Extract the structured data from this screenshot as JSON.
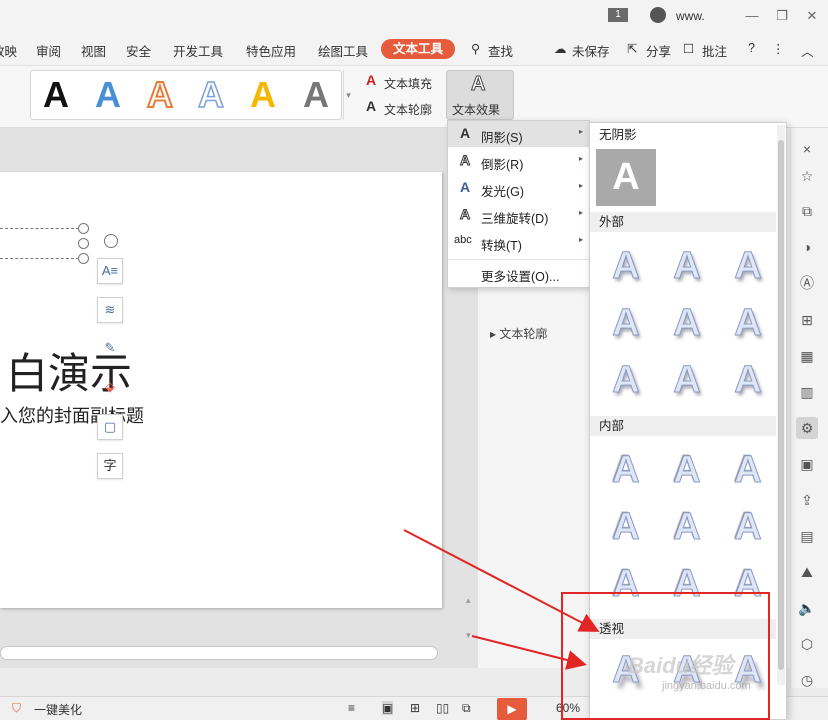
{
  "titlebar": {
    "page_indicator": "1",
    "user_name": "www.",
    "min": "—",
    "restore": "❐",
    "close": "✕"
  },
  "menu_tabs": [
    "放映",
    "审阅",
    "视图",
    "安全",
    "开发工具",
    "特色应用",
    "绘图工具"
  ],
  "active_tab": "文本工具",
  "search_label": "查找",
  "toolbar_right": {
    "unsaved": "未保存",
    "share": "分享",
    "annotate": "批注",
    "help": "?",
    "more": "⋮",
    "collapse": "︿"
  },
  "style_colors": [
    "#111111",
    "#4a8fd4",
    "#e67c3a",
    "#7aa2d8",
    "#f5b800",
    "#777777"
  ],
  "style_glyph": "A",
  "ribbon": {
    "text_fill": "文本填充",
    "text_outline": "文本轮廓",
    "text_effect": "文本效果"
  },
  "slide": {
    "title": "白演示",
    "subtitle": "入您的封面副标题"
  },
  "pane": {
    "text_outline": "文本轮廓"
  },
  "dropdown": [
    {
      "icon": "A",
      "label": "阴影(S)",
      "arrow": "▸"
    },
    {
      "icon": "A",
      "label": "倒影(R)",
      "arrow": "▸"
    },
    {
      "icon": "A",
      "label": "发光(G)",
      "arrow": "▸"
    },
    {
      "icon": "A",
      "label": "三维旋转(D)",
      "arrow": "▸"
    },
    {
      "icon": "abc",
      "label": "转换(T)",
      "arrow": "▸"
    },
    {
      "icon": "",
      "label": "更多设置(O)...",
      "arrow": ""
    }
  ],
  "shadow_gallery": {
    "no_shadow": "无阴影",
    "outer": "外部",
    "inner": "内部",
    "perspective": "透视",
    "glyph": "A"
  },
  "statusbar": {
    "beautify": "一键美化",
    "zoom": "60%"
  },
  "watermark": {
    "logo": "Baidu经验",
    "url": "jingyan.baidu.com"
  }
}
